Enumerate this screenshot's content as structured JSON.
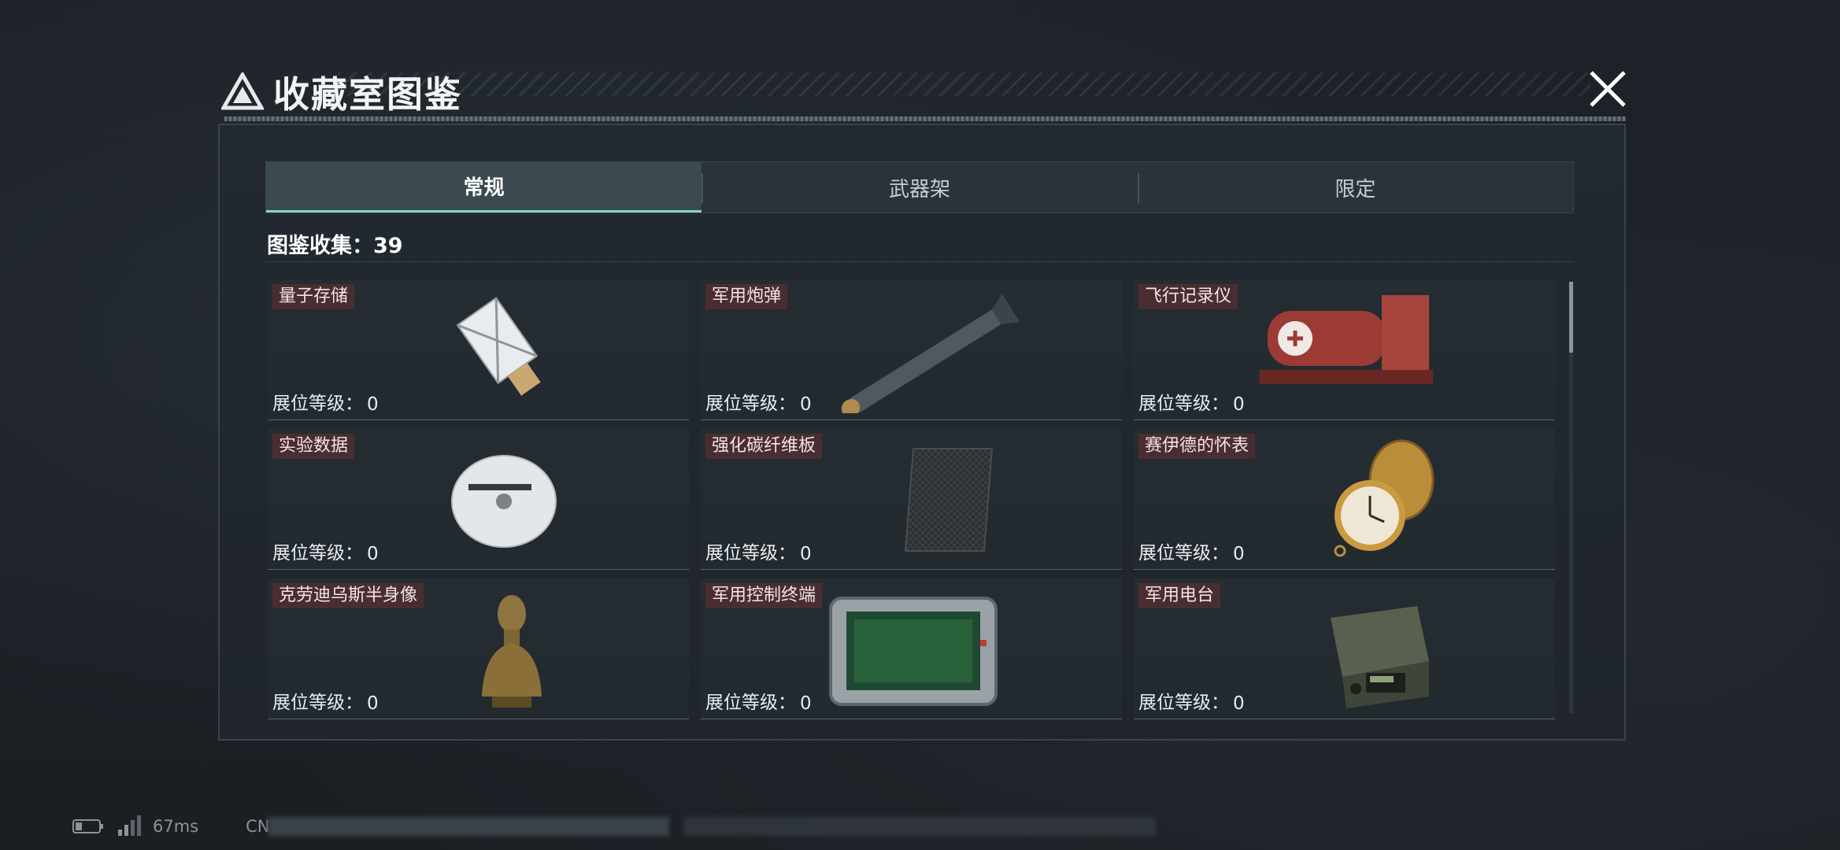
{
  "header": {
    "title": "收藏室图鉴"
  },
  "tabs": [
    {
      "label": "常规",
      "active": true
    },
    {
      "label": "武器架",
      "active": false
    },
    {
      "label": "限定",
      "active": false
    }
  ],
  "collection": {
    "text": "图鉴收集：39"
  },
  "level_label": "展位等级：",
  "items": [
    {
      "name": "量子存储",
      "level": "0",
      "icon": "usb-drive-icon"
    },
    {
      "name": "军用炮弹",
      "level": "0",
      "icon": "missile-icon"
    },
    {
      "name": "飞行记录仪",
      "level": "0",
      "icon": "flight-recorder-icon"
    },
    {
      "name": "实验数据",
      "level": "0",
      "icon": "disc-icon"
    },
    {
      "name": "强化碳纤维板",
      "level": "0",
      "icon": "carbon-plate-icon"
    },
    {
      "name": "赛伊德的怀表",
      "level": "0",
      "icon": "pocket-watch-icon"
    },
    {
      "name": "克劳迪乌斯半身像",
      "level": "0",
      "icon": "bust-icon"
    },
    {
      "name": "军用控制终端",
      "level": "0",
      "icon": "tablet-icon"
    },
    {
      "name": "军用电台",
      "level": "0",
      "icon": "radio-icon"
    }
  ],
  "status": {
    "ping": "67ms",
    "region": "CN"
  },
  "colors": {
    "tab_active_accent": "#7fd7c1",
    "name_badge": "#4a2d30"
  }
}
